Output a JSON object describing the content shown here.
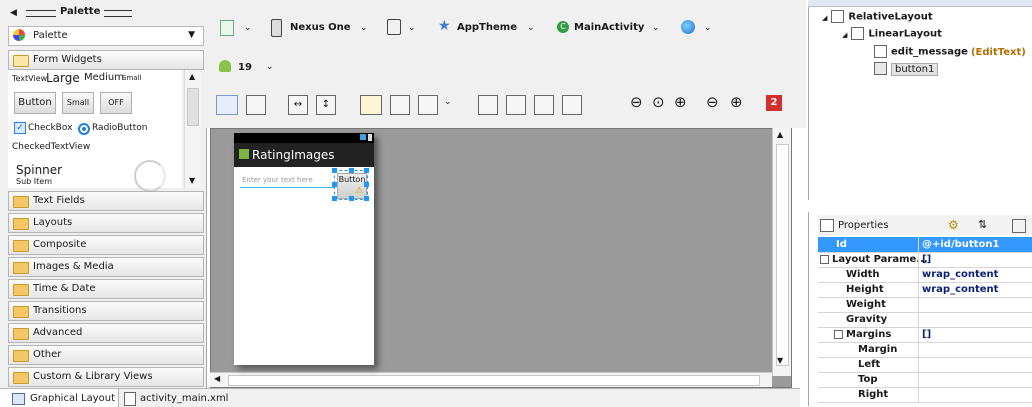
{
  "palette": {
    "title": "Palette",
    "dropdown_label": "Palette",
    "open_category": "Form Widgets",
    "widgets": {
      "textview": "TextView",
      "large": "Large",
      "medium": "Medium",
      "small": "Small",
      "button": "Button",
      "small_button": "Small",
      "off": "OFF",
      "checkbox": "CheckBox",
      "radiobutton": "RadioButton",
      "checkedtextview": "CheckedTextView",
      "spinner": "Spinner",
      "sub_item": "Sub Item"
    },
    "categories": [
      "Text Fields",
      "Layouts",
      "Composite",
      "Images & Media",
      "Time & Date",
      "Transitions",
      "Advanced",
      "Other",
      "Custom & Library Views"
    ]
  },
  "toolbar": {
    "device": "Nexus One",
    "theme": "AppTheme",
    "activity": "MainActivity",
    "api": "19",
    "error_count": "2"
  },
  "phone": {
    "app_title": "RatingImages",
    "edit_hint": "Enter your text here",
    "button_text": "Button"
  },
  "outline": {
    "items": [
      {
        "label": "RelativeLayout",
        "suffix": ""
      },
      {
        "label": "LinearLayout",
        "suffix": ""
      },
      {
        "label": "edit_message",
        "suffix": "(EditText)"
      },
      {
        "label": "button1",
        "suffix": ""
      }
    ]
  },
  "properties": {
    "title": "Properties",
    "rows": [
      {
        "key": "Id",
        "value": "@+id/button1"
      },
      {
        "key": "Layout Parame...",
        "value": "[]"
      },
      {
        "key": "Width",
        "value": "wrap_content"
      },
      {
        "key": "Height",
        "value": "wrap_content"
      },
      {
        "key": "Weight",
        "value": ""
      },
      {
        "key": "Gravity",
        "value": ""
      },
      {
        "key": "Margins",
        "value": "[]"
      },
      {
        "key": "Margin",
        "value": ""
      },
      {
        "key": "Left",
        "value": ""
      },
      {
        "key": "Top",
        "value": ""
      },
      {
        "key": "Right",
        "value": ""
      }
    ]
  },
  "tabs": {
    "graphical": "Graphical Layout",
    "xml": "activity_main.xml"
  }
}
